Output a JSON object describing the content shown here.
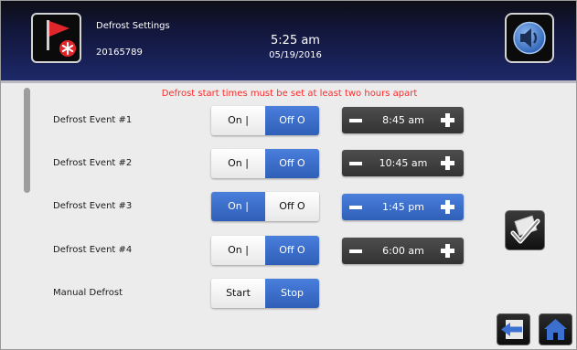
{
  "header": {
    "title": "Defrost Settings",
    "id": "20165789",
    "time": "5:25 am",
    "date": "05/19/2016"
  },
  "warning": "Defrost start times must be set at least two hours apart",
  "events": [
    {
      "label": "Defrost Event #1",
      "on_label": "On |",
      "off_label": "Off O",
      "state": "off",
      "time": "8:45 am"
    },
    {
      "label": "Defrost Event #2",
      "on_label": "On |",
      "off_label": "Off O",
      "state": "off",
      "time": "10:45 am"
    },
    {
      "label": "Defrost Event #3",
      "on_label": "On |",
      "off_label": "Off O",
      "state": "on",
      "time": "1:45 pm"
    },
    {
      "label": "Defrost Event #4",
      "on_label": "On |",
      "off_label": "Off O",
      "state": "off",
      "time": "6:00 am"
    }
  ],
  "manual": {
    "label": "Manual Defrost",
    "start_label": "Start",
    "stop_label": "Stop",
    "active": "stop"
  },
  "icons": {
    "defrost": "defrost-flag-icon",
    "speaker": "speaker-icon",
    "confirm": "checkmark-icon",
    "back": "back-arrow-icon",
    "home": "home-icon"
  },
  "colors": {
    "accent_blue": "#3b6fd0",
    "stepper_dark": "#3d3d3d",
    "warning_red": "#ff2b2b",
    "header_navy": "#1d2868"
  }
}
